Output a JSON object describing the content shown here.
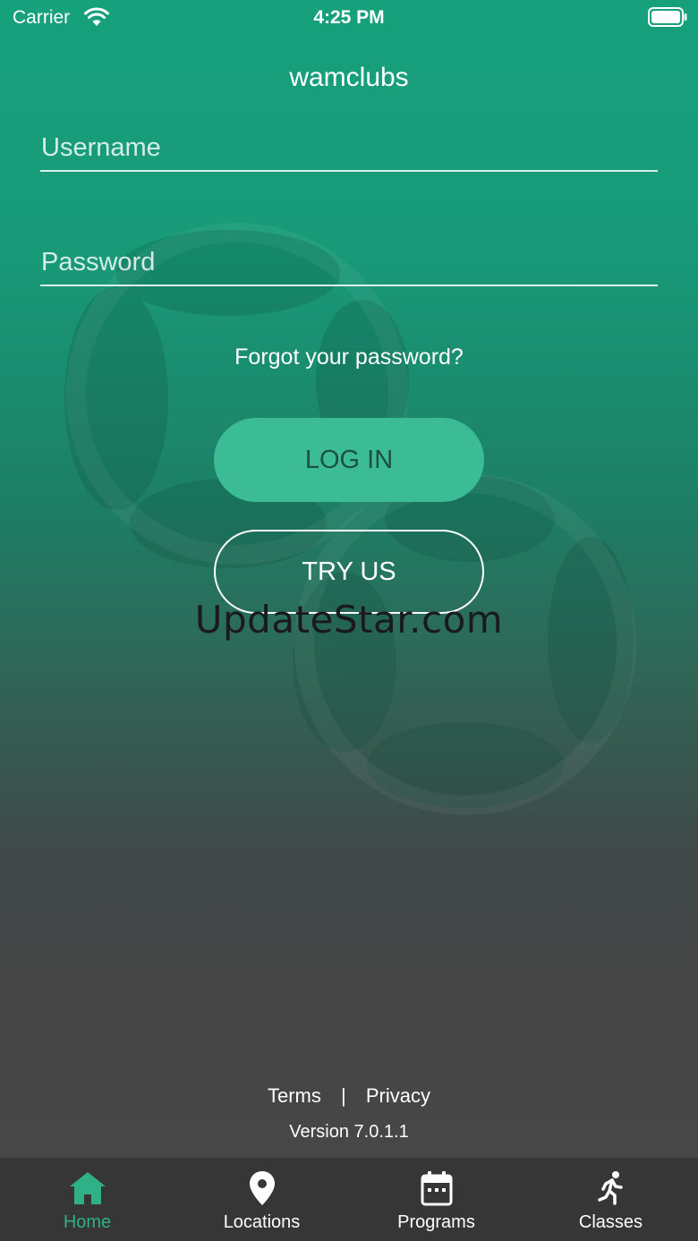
{
  "status_bar": {
    "carrier": "Carrier",
    "time": "4:25 PM"
  },
  "app": {
    "title": "wamclubs"
  },
  "login_form": {
    "username_placeholder": "Username",
    "password_placeholder": "Password",
    "forgot_password": "Forgot your password?",
    "login_button": "LOG IN",
    "tryus_button": "TRY US"
  },
  "watermark": "UpdateStar.com",
  "footer": {
    "terms": "Terms",
    "separator": "|",
    "privacy": "Privacy",
    "version": "Version 7.0.1.1"
  },
  "tab_bar": {
    "tabs": [
      {
        "label": "Home",
        "icon": "home-icon",
        "active": true
      },
      {
        "label": "Locations",
        "icon": "location-pin-icon",
        "active": false
      },
      {
        "label": "Programs",
        "icon": "calendar-icon",
        "active": false
      },
      {
        "label": "Classes",
        "icon": "running-person-icon",
        "active": false
      }
    ]
  },
  "colors": {
    "accent": "#3bbc94",
    "active_tab": "#2fb087",
    "tab_bar_bg": "#363636",
    "header_green": "#17a07c"
  }
}
